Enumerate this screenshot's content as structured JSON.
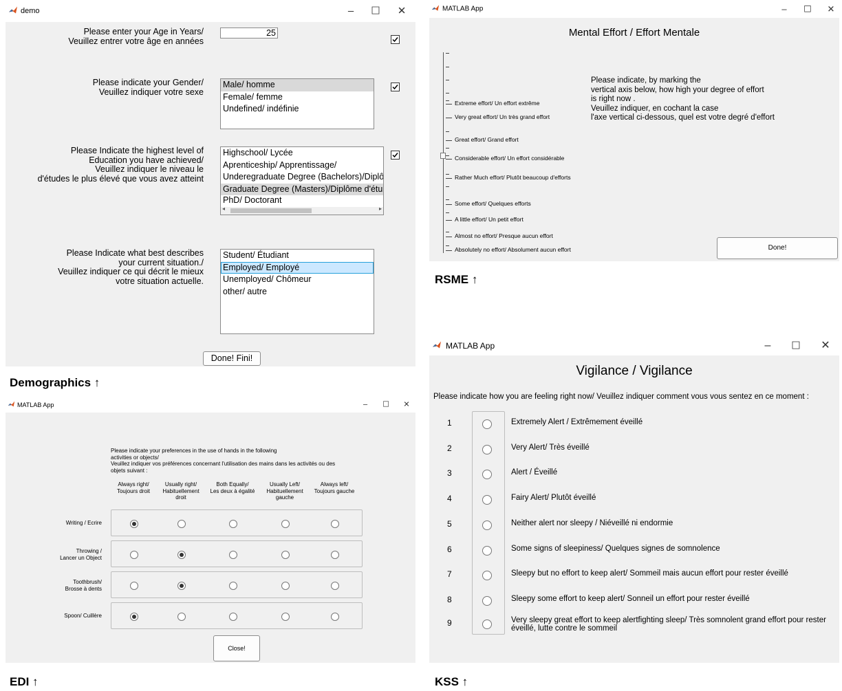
{
  "demo": {
    "window_title": "demo",
    "age_label": "Please enter your Age in Years/\nVeuillez entrer votre âge en années",
    "age_value": "25",
    "gender_label": "Please indicate your Gender/\nVeuillez indiquer votre sexe",
    "gender_options": [
      "Male/ homme",
      "Female/ femme",
      "Undefined/ indéfinie"
    ],
    "education_label": "Please Indicate the highest level of\nEducation you have achieved/\nVeuillez indiquer le niveau le\nd'études le plus élevé que vous avez atteint",
    "education_options": [
      "Highschool/ Lycée",
      "Aprenticeship/ Apprentissage/",
      "Underegraduate Degree (Bachelors)/Diplô",
      "Graduate Degree (Masters)/Diplôme d'étu",
      "PhD/ Doctorant"
    ],
    "situation_label": "Please Indicate what best describes\nyour current situation./\nVeuillez indiquer ce qui décrit le mieux\nvotre situation actuelle.",
    "situation_options": [
      "Student/ Étudiant",
      "Employed/ Employé",
      "Unemployed/ Chômeur",
      "other/ autre"
    ],
    "done_button": "Done! Fini!",
    "caption": "Demographics ↑"
  },
  "rsme": {
    "window_title": "MATLAB App",
    "heading": "Mental Effort / Effort Mentale",
    "instructions": "Please indicate, by marking the\nvertical axis below, how high your degree of effort\nis right now .\nVeuillez indiquer, en cochant la case\nl'axe vertical ci-dessous, quel est votre degré d'effort",
    "scale_labels": [
      "Extreme effort/ Un effort extrême",
      "Very great effort/ Un très grand effort",
      "Great effort/ Grand effort",
      "Considerable effort/ Un effort considérable",
      "Rather Much effort/ Plutôt beaucoup d'efforts",
      "Some effort/ Quelques efforts",
      "A little effort/ Un petit effort",
      "Almost no effort/ Presque aucun effort",
      "Absolutely no effort/ Absolument aucun effort"
    ],
    "done_button": "Done!",
    "caption": "RSME ↑"
  },
  "edi": {
    "window_title": "MATLAB App",
    "instructions": "Please indicate your preferences in the use of hands in the following\nactivities or objects/\nVeuillez indiquer vos préférences concernant l'utilisation des mains dans les activités ou des\nobjets suivant :",
    "columns": [
      "Always right/\nToujours droit",
      "Usually right/\nHabituellement\ndroit",
      "Both Equally/\nLes deux à égalité",
      "Usually Left/\nHabituellement\ngauche",
      "Always left/\nToujours gauche"
    ],
    "rows": [
      {
        "label": "Writing / Ecrire",
        "selected": 0
      },
      {
        "label": "Throwing /\nLancer un Object",
        "selected": 1
      },
      {
        "label": "Toothbrush/\nBrosse à dents",
        "selected": 1
      },
      {
        "label": "Spoon/ Cuillère",
        "selected": 0
      }
    ],
    "close_button": "Close!",
    "caption": "EDI ↑"
  },
  "kss": {
    "window_title": "MATLAB App",
    "heading": "Vigilance / Vigilance",
    "prompt": "Please indicate how you are feeling right now/ Veuillez indiquer comment vous vous sentez en ce moment :",
    "levels": [
      {
        "num": "1",
        "text": "Extremely Alert / Extrêmement éveillé"
      },
      {
        "num": "2",
        "text": "Very Alert/ Très éveillé"
      },
      {
        "num": "3",
        "text": "Alert / Éveillé"
      },
      {
        "num": "4",
        "text": "Fairy Alert/ Plutôt éveillé"
      },
      {
        "num": "5",
        "text": "Neither alert nor sleepy / Niéveillé ni endormie"
      },
      {
        "num": "6",
        "text": "Some signs of sleepiness/ Quelques signes de somnolence"
      },
      {
        "num": "7",
        "text": "Sleepy but no effort to keep alert/ Sommeil mais aucun effort pour rester éveillé"
      },
      {
        "num": "8",
        "text": "Sleepy some effort to keep alert/ Sonneil un effort pour rester éveillé"
      },
      {
        "num": "9",
        "text": "Very sleepy great effort to keep alertfighting sleep/ Très somnolent grand effort pour rester\néveillé, lutte contre le sommeil"
      }
    ],
    "caption": "KSS ↑"
  },
  "colors": {
    "selection_blue": "#cce8ff",
    "selection_border": "#26a0da",
    "window_bg": "#f0f0f0"
  }
}
